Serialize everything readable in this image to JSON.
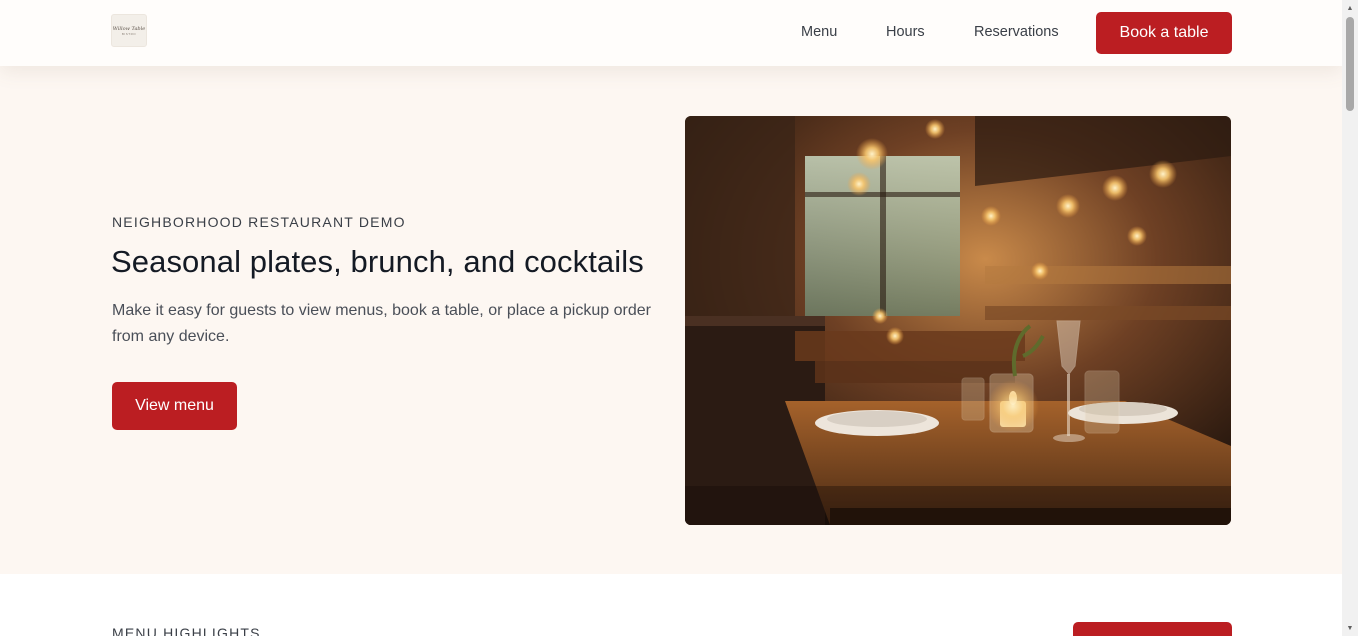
{
  "header": {
    "logo_alt": "Willow Table",
    "logo_script": "Willow Table",
    "logo_small": "BISTRO",
    "nav": [
      {
        "label": "Menu"
      },
      {
        "label": "Hours"
      },
      {
        "label": "Reservations"
      }
    ],
    "cta_label": "Book a table"
  },
  "hero": {
    "eyebrow": "NEIGHBORHOOD RESTAURANT DEMO",
    "title": "Seasonal plates, brunch, and cocktails",
    "description": "Make it easy for guests to view menus, book a table, or place a pickup order from any device.",
    "cta_label": "View menu",
    "image_alt": "Warm candlelit restaurant dining room with set wooden tables"
  },
  "section2": {
    "eyebrow": "MENU HIGHLIGHTS"
  },
  "colors": {
    "accent": "#bb1e22",
    "hero_bg": "#fdf7f2",
    "header_bg": "#fffdfb"
  },
  "icons": {
    "scroll_up": "▲",
    "scroll_down": "▼"
  }
}
